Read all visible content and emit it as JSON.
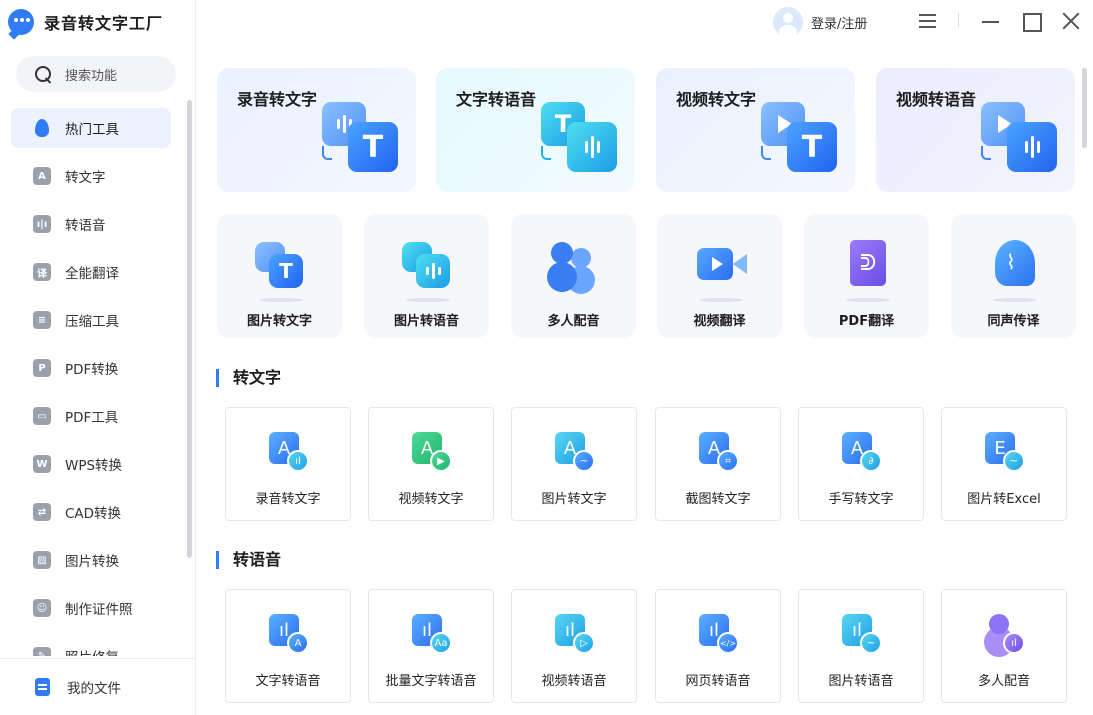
{
  "app": {
    "title": "录音转文字工厂"
  },
  "search": {
    "placeholder": "搜索功能"
  },
  "sidebar": {
    "items": [
      {
        "label": "热门工具",
        "icon": "flame-icon",
        "glyph": ""
      },
      {
        "label": "转文字",
        "icon": "text-convert-icon",
        "glyph": "A"
      },
      {
        "label": "转语音",
        "icon": "audio-convert-icon",
        "glyph": "ı|ı"
      },
      {
        "label": "全能翻译",
        "icon": "translate-icon",
        "glyph": "译"
      },
      {
        "label": "压缩工具",
        "icon": "compress-icon",
        "glyph": "≡"
      },
      {
        "label": "PDF转换",
        "icon": "pdf-convert-icon",
        "glyph": "P"
      },
      {
        "label": "PDF工具",
        "icon": "briefcase-icon",
        "glyph": "▭"
      },
      {
        "label": "WPS转换",
        "icon": "wps-icon",
        "glyph": "W"
      },
      {
        "label": "CAD转换",
        "icon": "cad-icon",
        "glyph": "⇄"
      },
      {
        "label": "图片转换",
        "icon": "image-icon",
        "glyph": "▨"
      },
      {
        "label": "制作证件照",
        "icon": "id-photo-icon",
        "glyph": "☺"
      },
      {
        "label": "照片修复",
        "icon": "photo-repair-icon",
        "glyph": "✎"
      }
    ],
    "active_index": 0,
    "my_files": "我的文件"
  },
  "topbar": {
    "login_label": "登录/注册"
  },
  "features": [
    {
      "label": "录音转文字"
    },
    {
      "label": "文字转语音"
    },
    {
      "label": "视频转文字"
    },
    {
      "label": "视频转语音"
    }
  ],
  "tools": [
    {
      "label": "图片转文字"
    },
    {
      "label": "图片转语音"
    },
    {
      "label": "多人配音"
    },
    {
      "label": "视频翻译"
    },
    {
      "label": "PDF翻译"
    },
    {
      "label": "同声传译"
    }
  ],
  "sections": [
    {
      "title": "转文字",
      "cards": [
        {
          "label": "录音转文字",
          "letter": "A",
          "badge": "ıl"
        },
        {
          "label": "视频转文字",
          "letter": "A",
          "badge": "▶"
        },
        {
          "label": "图片转文字",
          "letter": "A",
          "badge": "~"
        },
        {
          "label": "截图转文字",
          "letter": "A",
          "badge": "⌗"
        },
        {
          "label": "手写转文字",
          "letter": "A",
          "badge": "∂"
        },
        {
          "label": "图片转Excel",
          "letter": "E",
          "badge": "~"
        }
      ]
    },
    {
      "title": "转语音",
      "cards": [
        {
          "label": "文字转语音",
          "letter": "ıl",
          "badge": "A"
        },
        {
          "label": "批量文字转语音",
          "letter": "ıl",
          "badge": "Aa"
        },
        {
          "label": "视频转语音",
          "letter": "ıl",
          "badge": "▷"
        },
        {
          "label": "网页转语音",
          "letter": "ıl",
          "badge": "</>"
        },
        {
          "label": "图片转语音",
          "letter": "ıl",
          "badge": "~"
        },
        {
          "label": "多人配音",
          "letter": "",
          "badge": "ıl"
        }
      ]
    }
  ],
  "colors": {
    "accent": "#2f7cf6"
  }
}
